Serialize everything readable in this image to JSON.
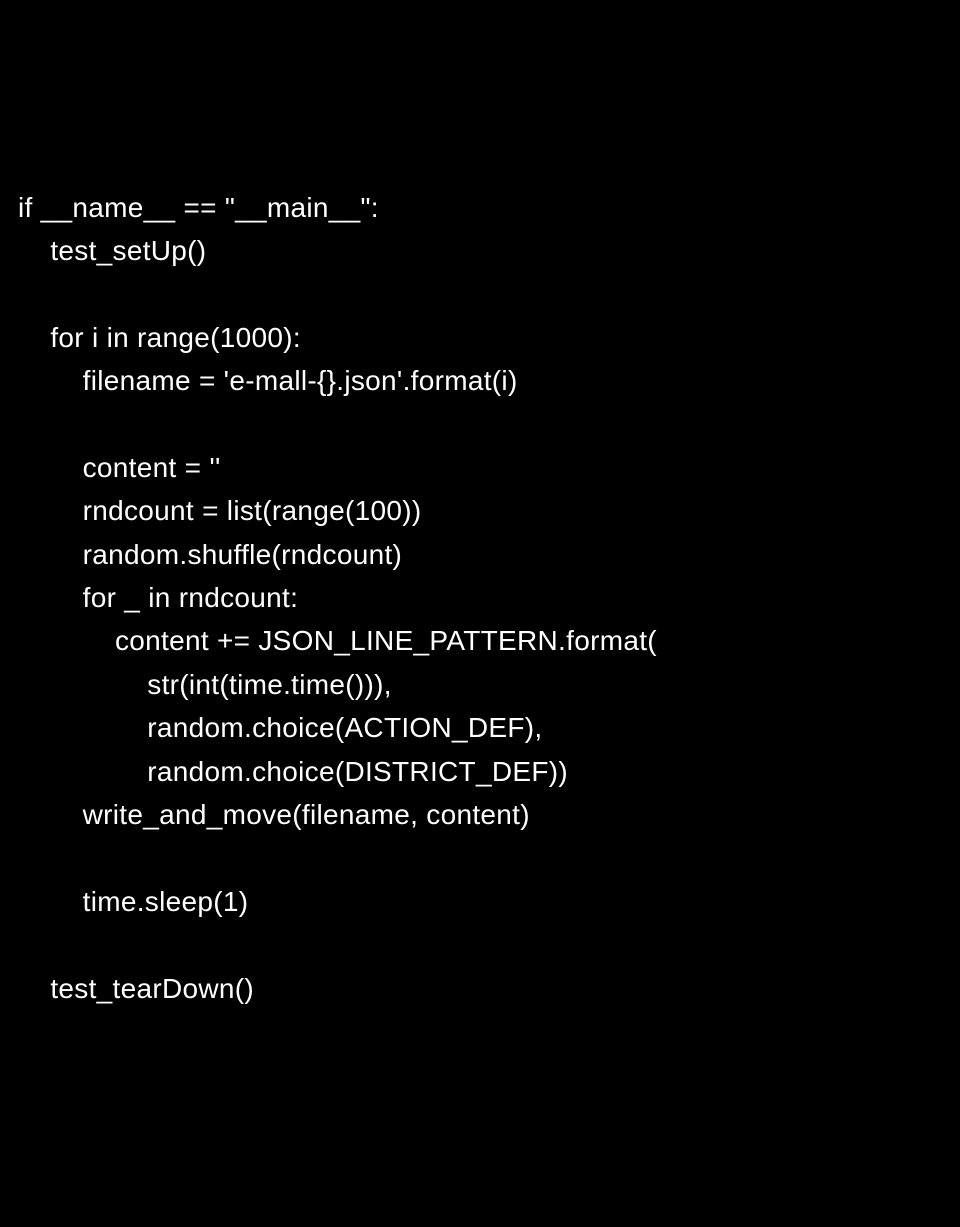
{
  "code": {
    "lines": [
      "if __name__ == \"__main__\":",
      "    test_setUp()",
      "",
      "    for i in range(1000):",
      "        filename = 'e-mall-{}.json'.format(i)",
      "",
      "        content = ''",
      "        rndcount = list(range(100))",
      "        random.shuffle(rndcount)",
      "        for _ in rndcount:",
      "            content += JSON_LINE_PATTERN.format(",
      "                str(int(time.time())),",
      "                random.choice(ACTION_DEF),",
      "                random.choice(DISTRICT_DEF))",
      "        write_and_move(filename, content)",
      "",
      "        time.sleep(1)",
      "",
      "    test_tearDown()"
    ]
  }
}
